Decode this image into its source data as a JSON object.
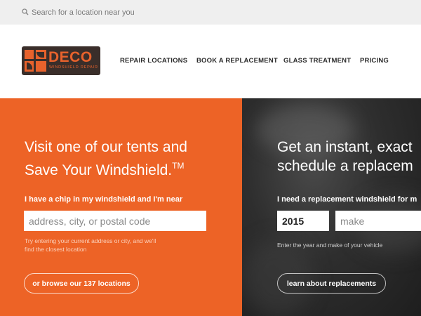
{
  "search": {
    "placeholder": "Search for a location near you"
  },
  "logo": {
    "name": "DECO",
    "tagline": "WINDSHIELD REPAIR"
  },
  "nav": {
    "items": [
      {
        "label": "REPAIR LOCATIONS"
      },
      {
        "label": "BOOK A REPLACEMENT"
      },
      {
        "label": "GLASS TREATMENT"
      },
      {
        "label": "PRICING"
      }
    ]
  },
  "hero_left": {
    "title_line1": "Visit one of our tents and",
    "title_line2": "Save Your Windshield.",
    "trademark": "TM",
    "label": "I have a chip in my windshield and I'm near",
    "input_placeholder": "address, city, or postal code",
    "hint_line1": "Try entering your current address or city, and we'll",
    "hint_line2": "find the closest location",
    "button": "or browse our 137 locations"
  },
  "hero_right": {
    "title_line1": "Get an instant, exact",
    "title_line2": "schedule a replacem",
    "label": "I need a replacement windshield for m",
    "year_value": "2015",
    "make_placeholder": "make",
    "hint": "Enter the year and make of your vehicle",
    "button": "learn about replacements"
  },
  "colors": {
    "accent": "#ed6326",
    "logo_bg": "#3a2e2a",
    "topbar": "#efefef"
  }
}
